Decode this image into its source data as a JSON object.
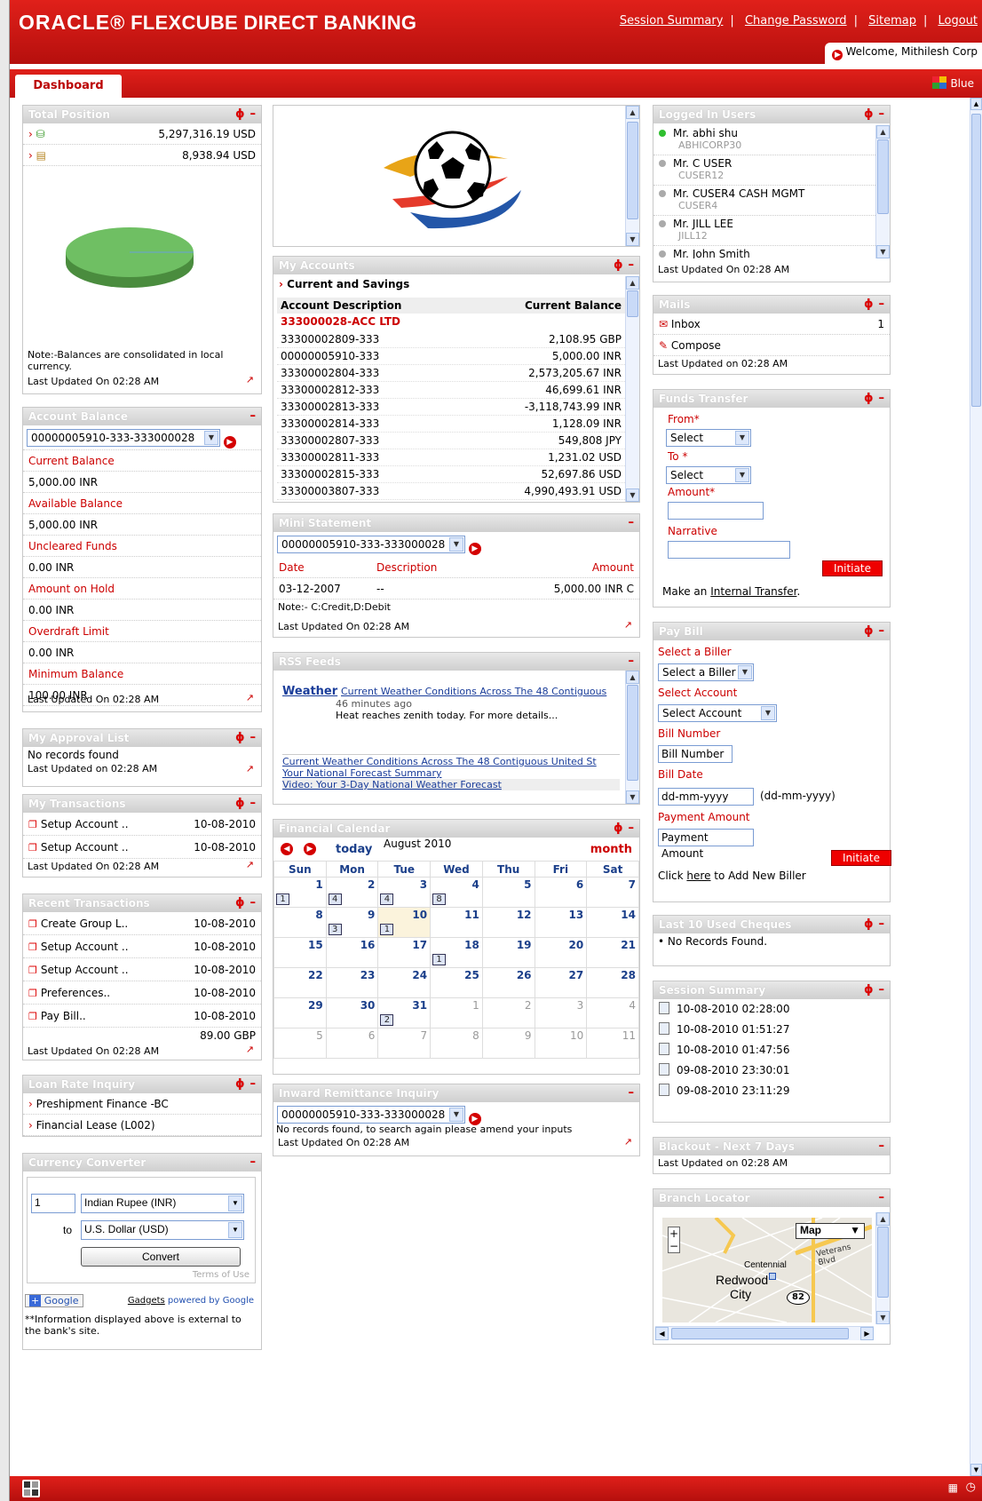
{
  "header": {
    "brand": "ORACLE",
    "product": "FLEXCUBE DIRECT BANKING",
    "links": [
      "Session Summary",
      "Change Password",
      "Sitemap",
      "Logout"
    ],
    "welcome": "Welcome,  Mithilesh Corp"
  },
  "tabs": {
    "dashboard": "Dashboard",
    "theme": "Blue"
  },
  "total_position": {
    "title": "Total Position",
    "rows": [
      {
        "icon": "money-bag-icon",
        "value": "5,297,316.19 USD"
      },
      {
        "icon": "money-stack-icon",
        "value": "8,938.94 USD"
      }
    ],
    "note": "Note:-Balances are consolidated in local currency.",
    "updated": "Last Updated On 02:28 AM"
  },
  "account_balance": {
    "title": "Account Balance",
    "account": "00000005910-333-333000028",
    "items": [
      {
        "label": "Current Balance",
        "value": "5,000.00  INR"
      },
      {
        "label": "Available Balance",
        "value": "5,000.00  INR"
      },
      {
        "label": "Uncleared Funds",
        "value": "0.00  INR"
      },
      {
        "label": "Amount on Hold",
        "value": "0.00  INR"
      },
      {
        "label": "Overdraft Limit",
        "value": "0.00  INR"
      },
      {
        "label": "Minimum Balance",
        "value": "100.00  INR"
      }
    ],
    "updated": "Last Updated On 02:28 AM"
  },
  "approval": {
    "title": "My Approval List",
    "message": "No records found",
    "updated": "Last Updated on 02:28 AM"
  },
  "my_transactions": {
    "title": "My Transactions",
    "rows": [
      {
        "label": "Setup Account ..",
        "date": "10-08-2010"
      },
      {
        "label": "Setup Account ..",
        "date": "10-08-2010"
      }
    ],
    "updated": "Last Updated On 02:28 AM"
  },
  "recent_transactions": {
    "title": "Recent Transactions",
    "rows": [
      {
        "label": "Create Group L..",
        "date": "10-08-2010"
      },
      {
        "label": "Setup Account ..",
        "date": "10-08-2010"
      },
      {
        "label": "Setup Account ..",
        "date": "10-08-2010"
      },
      {
        "label": "Preferences..",
        "date": "10-08-2010"
      },
      {
        "label": "Pay Bill..",
        "date": "10-08-2010"
      }
    ],
    "extra_amount": "89.00 GBP",
    "updated": "Last Updated On 02:28 AM"
  },
  "loan_rate": {
    "title": "Loan Rate Inquiry",
    "items": [
      "Preshipment Finance -BC",
      "Financial Lease (L002)"
    ]
  },
  "currency": {
    "title": "Currency Converter",
    "amount": "1",
    "from": "Indian Rupee (INR)",
    "to_label": "to",
    "to": "U.S. Dollar (USD)",
    "convert": "Convert",
    "terms": "Terms of Use",
    "google": "Google",
    "gadgets": "Gadgets",
    "powered": "powered by Google",
    "disclaimer": "**Information displayed above is external to the bank's site."
  },
  "my_accounts": {
    "title": "My Accounts",
    "section": "Current and Savings",
    "col_desc": "Account Description",
    "col_bal": "Current Balance",
    "group": "333000028-ACC LTD",
    "rows": [
      {
        "acc": "33300002809-333",
        "bal": "2,108.95 GBP"
      },
      {
        "acc": "00000005910-333",
        "bal": "5,000.00 INR"
      },
      {
        "acc": "33300002804-333",
        "bal": "2,573,205.67 INR"
      },
      {
        "acc": "33300002812-333",
        "bal": "46,699.61 INR"
      },
      {
        "acc": "33300002813-333",
        "bal": "-3,118,743.99 INR"
      },
      {
        "acc": "33300002814-333",
        "bal": "1,128.09 INR"
      },
      {
        "acc": "33300002807-333",
        "bal": "549,808 JPY"
      },
      {
        "acc": "33300002811-333",
        "bal": "1,231.02 USD"
      },
      {
        "acc": "33300002815-333",
        "bal": "52,697.86 USD"
      },
      {
        "acc": "33300003807-333",
        "bal": "4,990,493.91 USD"
      }
    ]
  },
  "mini_statement": {
    "title": "Mini Statement",
    "account": "00000005910-333-333000028",
    "col_date": "Date",
    "col_desc": "Description",
    "col_amt": "Amount",
    "row": {
      "date": "03-12-2007",
      "desc": "--",
      "amt": "5,000.00  INR  C"
    },
    "note": "Note:- C:Credit,D:Debit",
    "updated": "Last Updated On 02:28 AM"
  },
  "rss": {
    "title": "RSS Feeds",
    "source": "Weather",
    "headline": "Current Weather Conditions Across The 48 Contiguous",
    "ago": "46 minutes ago",
    "snippet": "Heat reaches zenith today. For more details...",
    "links": [
      "Current Weather Conditions Across The 48 Contiguous United St",
      "Your National Forecast Summary",
      "Video: Your 3-Day National Weather Forecast"
    ]
  },
  "calendar": {
    "title": "Financial Calendar",
    "today": "today",
    "month_label": "August 2010",
    "view": "month",
    "days": [
      "Sun",
      "Mon",
      "Tue",
      "Wed",
      "Thu",
      "Fri",
      "Sat"
    ],
    "weeks": [
      [
        {
          "d": "1",
          "e": "1"
        },
        {
          "d": "2",
          "e": "4"
        },
        {
          "d": "3",
          "e": "4"
        },
        {
          "d": "4",
          "e": "8"
        },
        {
          "d": "5"
        },
        {
          "d": "6"
        },
        {
          "d": "7"
        }
      ],
      [
        {
          "d": "8"
        },
        {
          "d": "9",
          "e": "3"
        },
        {
          "d": "10",
          "e": "1",
          "t": true
        },
        {
          "d": "11"
        },
        {
          "d": "12"
        },
        {
          "d": "13"
        },
        {
          "d": "14"
        }
      ],
      [
        {
          "d": "15"
        },
        {
          "d": "16"
        },
        {
          "d": "17"
        },
        {
          "d": "18",
          "e": "1"
        },
        {
          "d": "19"
        },
        {
          "d": "20"
        },
        {
          "d": "21"
        }
      ],
      [
        {
          "d": "22"
        },
        {
          "d": "23"
        },
        {
          "d": "24"
        },
        {
          "d": "25"
        },
        {
          "d": "26"
        },
        {
          "d": "27"
        },
        {
          "d": "28"
        }
      ],
      [
        {
          "d": "29"
        },
        {
          "d": "30"
        },
        {
          "d": "31",
          "e": "2"
        },
        {
          "d": "1",
          "o": true
        },
        {
          "d": "2",
          "o": true
        },
        {
          "d": "3",
          "o": true
        },
        {
          "d": "4",
          "o": true
        }
      ],
      [
        {
          "d": "5",
          "o": true
        },
        {
          "d": "6",
          "o": true
        },
        {
          "d": "7",
          "o": true
        },
        {
          "d": "8",
          "o": true
        },
        {
          "d": "9",
          "o": true
        },
        {
          "d": "10",
          "o": true
        },
        {
          "d": "11",
          "o": true
        }
      ]
    ]
  },
  "inward": {
    "title": "Inward Remittance Inquiry",
    "account": "00000005910-333-333000028",
    "message": "No records found, to search again please amend your inputs",
    "updated": "Last Updated On 02:28 AM"
  },
  "logged_users": {
    "title": "Logged In Users",
    "users": [
      {
        "name": "Mr.  abhi  shu",
        "id": "ABHICORP30",
        "online": true
      },
      {
        "name": "Mr.  C  USER",
        "id": "CUSER12",
        "online": false
      },
      {
        "name": "Mr.  CUSER4  CASH MGMT",
        "id": "CUSER4",
        "online": false
      },
      {
        "name": "Mr.  JILL  LEE",
        "id": "JILL12",
        "online": false
      },
      {
        "name": "Mr.  John  Smith",
        "id": "",
        "online": false
      }
    ],
    "updated": "Last Updated On 02:28 AM"
  },
  "mails": {
    "title": "Mails",
    "inbox": "Inbox",
    "inbox_count": "1",
    "compose": "Compose",
    "updated": "Last Updated on 02:28 AM"
  },
  "funds": {
    "title": "Funds Transfer",
    "from": "From*",
    "from_sel": "Select",
    "to": "To *",
    "to_sel": "Select",
    "amount": "Amount*",
    "narrative": "Narrative",
    "initiate": "Initiate",
    "make_pre": "Make an",
    "make_link": "Internal Transfer",
    "make_post": "."
  },
  "paybill": {
    "title": "Pay Bill",
    "biller_label": "Select a Biller",
    "biller_sel": "Select a Biller",
    "account_label": "Select Account",
    "account_sel": "Select Account",
    "bill_no_label": "Bill Number",
    "bill_no_value": "Bill Number",
    "bill_date_label": "Bill Date",
    "bill_date_value": "dd-mm-yyyy",
    "bill_date_fmt": "(dd-mm-yyyy)",
    "pay_amt_label": "Payment Amount",
    "pay_amt_value": "Payment Amount",
    "initiate": "Initiate",
    "click_pre": "Click",
    "click_link": "here",
    "click_post": "to Add New Biller"
  },
  "cheques": {
    "title": "Last 10 Used Cheques",
    "message": "No Records Found."
  },
  "session": {
    "title": "Session Summary",
    "items": [
      "10-08-2010 02:28:00",
      "10-08-2010 01:51:27",
      "10-08-2010 01:47:56",
      "09-08-2010 23:30:01",
      "09-08-2010 23:11:29"
    ]
  },
  "blackout": {
    "title": "Blackout - Next 7 Days",
    "updated": "Last Updated on 02:28 AM"
  },
  "branch": {
    "title": "Branch Locator",
    "map_type": "Map",
    "labels": [
      "Centennial",
      "Redwood",
      "City",
      "82",
      "Veterans Blvd"
    ]
  }
}
